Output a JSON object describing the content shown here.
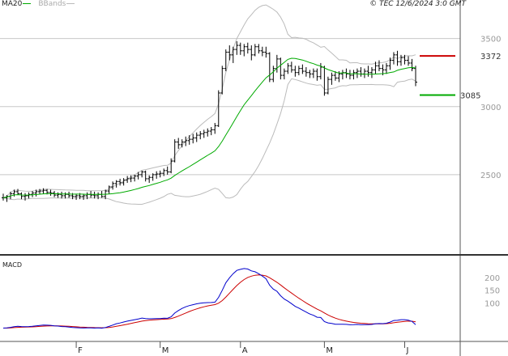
{
  "header": {
    "ma_label": "MA20",
    "bb_label": "BBands",
    "copyright": "© TEC 12/6/2024 3:0 GMT"
  },
  "colors": {
    "price": "#000000",
    "ma20": "#00aa00",
    "bbands": "#bbbbbb",
    "resistance": "#cc0000",
    "support": "#00aa00",
    "macd": "#0000cc",
    "signal": "#cc0000",
    "grid": "#c8c8c8",
    "axis_text": "#999999"
  },
  "chart_data": [
    {
      "type": "candlestick",
      "title": "",
      "ylim": [
        2000,
        3700
      ],
      "y_ticks": [
        2500,
        3000,
        3500
      ],
      "x_ticks": [
        "F",
        "M",
        "A",
        "M",
        "J"
      ],
      "x_tick_index": [
        20,
        43,
        65,
        88,
        110
      ],
      "levels": [
        {
          "label": "3372",
          "value": 3372,
          "role": "resistance"
        },
        {
          "label": "3085",
          "value": 3085,
          "role": "support"
        }
      ],
      "series": [
        {
          "name": "MA20",
          "type": "line"
        },
        {
          "name": "BBands",
          "type": "band"
        }
      ],
      "ohlc": [
        [
          2330,
          2360,
          2310,
          2330
        ],
        [
          2330,
          2350,
          2300,
          2340
        ],
        [
          2340,
          2375,
          2320,
          2360
        ],
        [
          2360,
          2390,
          2340,
          2375
        ],
        [
          2375,
          2395,
          2350,
          2360
        ],
        [
          2360,
          2370,
          2320,
          2340
        ],
        [
          2340,
          2365,
          2310,
          2345
        ],
        [
          2345,
          2370,
          2325,
          2355
        ],
        [
          2355,
          2380,
          2335,
          2365
        ],
        [
          2365,
          2390,
          2340,
          2375
        ],
        [
          2375,
          2395,
          2355,
          2380
        ],
        [
          2380,
          2400,
          2360,
          2385
        ],
        [
          2385,
          2395,
          2355,
          2370
        ],
        [
          2370,
          2390,
          2345,
          2365
        ],
        [
          2365,
          2380,
          2335,
          2350
        ],
        [
          2350,
          2370,
          2330,
          2355
        ],
        [
          2355,
          2375,
          2325,
          2345
        ],
        [
          2345,
          2370,
          2325,
          2355
        ],
        [
          2355,
          2375,
          2330,
          2345
        ],
        [
          2345,
          2365,
          2320,
          2340
        ],
        [
          2340,
          2360,
          2315,
          2345
        ],
        [
          2345,
          2365,
          2320,
          2340
        ],
        [
          2340,
          2360,
          2315,
          2345
        ],
        [
          2345,
          2370,
          2320,
          2355
        ],
        [
          2355,
          2380,
          2330,
          2350
        ],
        [
          2350,
          2375,
          2325,
          2345
        ],
        [
          2345,
          2370,
          2320,
          2355
        ],
        [
          2355,
          2380,
          2330,
          2340
        ],
        [
          2340,
          2390,
          2320,
          2380
        ],
        [
          2380,
          2420,
          2360,
          2410
        ],
        [
          2410,
          2450,
          2390,
          2435
        ],
        [
          2435,
          2460,
          2405,
          2450
        ],
        [
          2450,
          2470,
          2420,
          2440
        ],
        [
          2440,
          2475,
          2420,
          2460
        ],
        [
          2460,
          2490,
          2440,
          2470
        ],
        [
          2470,
          2495,
          2445,
          2475
        ],
        [
          2475,
          2500,
          2450,
          2490
        ],
        [
          2490,
          2520,
          2465,
          2500
        ],
        [
          2500,
          2530,
          2480,
          2520
        ],
        [
          2520,
          2530,
          2450,
          2470
        ],
        [
          2470,
          2495,
          2440,
          2480
        ],
        [
          2480,
          2510,
          2455,
          2500
        ],
        [
          2500,
          2525,
          2470,
          2505
        ],
        [
          2505,
          2530,
          2480,
          2510
        ],
        [
          2510,
          2545,
          2490,
          2530
        ],
        [
          2530,
          2560,
          2500,
          2520
        ],
        [
          2520,
          2620,
          2510,
          2600
        ],
        [
          2600,
          2760,
          2590,
          2740
        ],
        [
          2740,
          2770,
          2690,
          2720
        ],
        [
          2720,
          2760,
          2700,
          2740
        ],
        [
          2740,
          2780,
          2710,
          2750
        ],
        [
          2750,
          2790,
          2720,
          2760
        ],
        [
          2760,
          2800,
          2730,
          2770
        ],
        [
          2770,
          2810,
          2740,
          2790
        ],
        [
          2790,
          2820,
          2760,
          2800
        ],
        [
          2800,
          2830,
          2770,
          2810
        ],
        [
          2810,
          2840,
          2780,
          2820
        ],
        [
          2820,
          2850,
          2790,
          2830
        ],
        [
          2830,
          2880,
          2800,
          2860
        ],
        [
          2860,
          3120,
          2850,
          3100
        ],
        [
          3100,
          3300,
          3090,
          3280
        ],
        [
          3280,
          3420,
          3260,
          3400
        ],
        [
          3400,
          3450,
          3340,
          3380
        ],
        [
          3380,
          3440,
          3320,
          3420
        ],
        [
          3420,
          3480,
          3380,
          3450
        ],
        [
          3450,
          3470,
          3380,
          3410
        ],
        [
          3410,
          3460,
          3370,
          3440
        ],
        [
          3440,
          3470,
          3390,
          3420
        ],
        [
          3420,
          3450,
          3340,
          3380
        ],
        [
          3380,
          3460,
          3370,
          3440
        ],
        [
          3440,
          3460,
          3390,
          3410
        ],
        [
          3410,
          3440,
          3370,
          3400
        ],
        [
          3400,
          3440,
          3360,
          3390
        ],
        [
          3390,
          3400,
          3180,
          3200
        ],
        [
          3200,
          3300,
          3180,
          3280
        ],
        [
          3280,
          3380,
          3250,
          3350
        ],
        [
          3350,
          3360,
          3200,
          3230
        ],
        [
          3230,
          3280,
          3200,
          3260
        ],
        [
          3260,
          3320,
          3240,
          3300
        ],
        [
          3300,
          3330,
          3250,
          3270
        ],
        [
          3270,
          3300,
          3220,
          3250
        ],
        [
          3250,
          3300,
          3230,
          3280
        ],
        [
          3280,
          3310,
          3240,
          3260
        ],
        [
          3260,
          3290,
          3220,
          3250
        ],
        [
          3250,
          3270,
          3210,
          3240
        ],
        [
          3240,
          3280,
          3210,
          3260
        ],
        [
          3260,
          3280,
          3190,
          3220
        ],
        [
          3220,
          3320,
          3200,
          3290
        ],
        [
          3290,
          3300,
          3080,
          3100
        ],
        [
          3100,
          3220,
          3090,
          3200
        ],
        [
          3200,
          3250,
          3160,
          3230
        ],
        [
          3230,
          3260,
          3190,
          3210
        ],
        [
          3210,
          3260,
          3180,
          3240
        ],
        [
          3240,
          3270,
          3200,
          3250
        ],
        [
          3250,
          3280,
          3210,
          3240
        ],
        [
          3240,
          3270,
          3200,
          3230
        ],
        [
          3230,
          3270,
          3200,
          3250
        ],
        [
          3250,
          3280,
          3210,
          3260
        ],
        [
          3260,
          3290,
          3220,
          3240
        ],
        [
          3240,
          3280,
          3210,
          3260
        ],
        [
          3260,
          3300,
          3220,
          3250
        ],
        [
          3250,
          3290,
          3210,
          3270
        ],
        [
          3270,
          3330,
          3240,
          3300
        ],
        [
          3300,
          3340,
          3260,
          3280
        ],
        [
          3280,
          3310,
          3230,
          3270
        ],
        [
          3270,
          3320,
          3240,
          3300
        ],
        [
          3300,
          3360,
          3270,
          3340
        ],
        [
          3340,
          3400,
          3310,
          3380
        ],
        [
          3380,
          3410,
          3300,
          3330
        ],
        [
          3330,
          3380,
          3300,
          3360
        ],
        [
          3360,
          3380,
          3310,
          3340
        ],
        [
          3340,
          3370,
          3300,
          3320
        ],
        [
          3320,
          3350,
          3260,
          3280
        ],
        [
          3280,
          3300,
          3150,
          3180
        ]
      ]
    },
    {
      "type": "line",
      "title": "MACD",
      "ylim": [
        -40,
        280
      ],
      "y_ticks": [
        100,
        150,
        200
      ],
      "series": [
        {
          "name": "MACD"
        },
        {
          "name": "Signal"
        }
      ]
    }
  ]
}
